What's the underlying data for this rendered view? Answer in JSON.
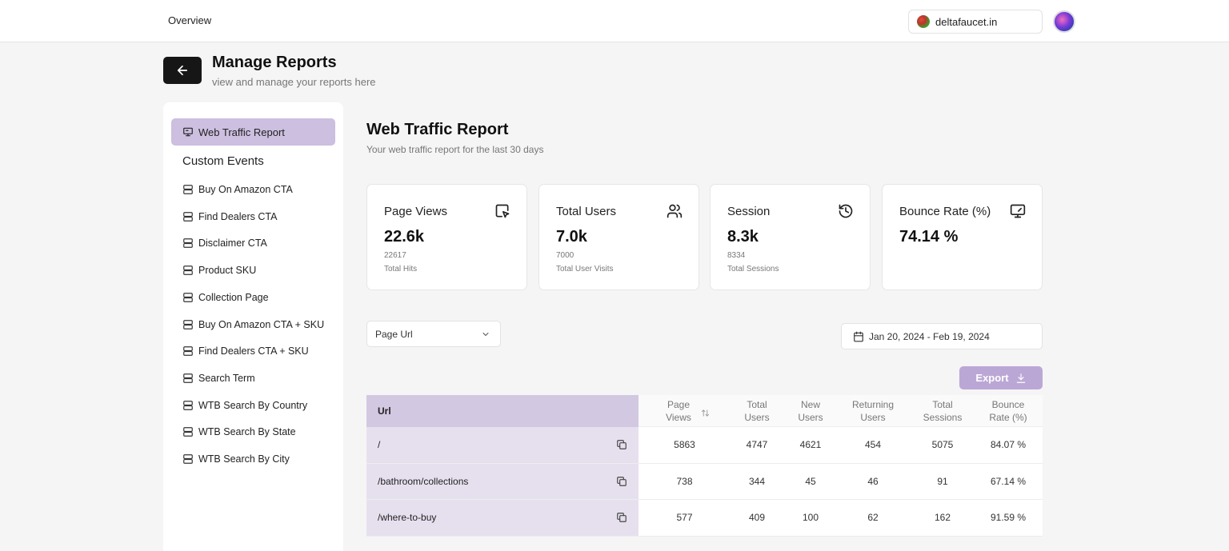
{
  "topbar": {
    "nav_overview": "Overview",
    "site": "deltafaucet.in"
  },
  "header": {
    "title": "Manage Reports",
    "subtitle": "view and manage your reports here"
  },
  "sidebar": {
    "active_item": "Web Traffic Report",
    "section_heading": "Custom Events",
    "items": [
      "Buy On Amazon CTA",
      "Find Dealers CTA",
      "Disclaimer CTA",
      "Product SKU",
      "Collection Page",
      "Buy On Amazon CTA + SKU",
      "Find Dealers CTA + SKU",
      "Search Term",
      "WTB Search By Country",
      "WTB Search By State",
      "WTB Search By City"
    ]
  },
  "report": {
    "title": "Web Traffic Report",
    "subtitle": "Your web traffic report for the last 30 days"
  },
  "cards": [
    {
      "title": "Page Views",
      "value": "22.6k",
      "raw": "22617",
      "caption": "Total Hits",
      "icon": "cursor-click-icon"
    },
    {
      "title": "Total Users",
      "value": "7.0k",
      "raw": "7000",
      "caption": "Total User Visits",
      "icon": "users-icon"
    },
    {
      "title": "Session",
      "value": "8.3k",
      "raw": "8334",
      "caption": "Total Sessions",
      "icon": "history-icon"
    },
    {
      "title": "Bounce Rate (%)",
      "value": "74.14 %",
      "raw": "",
      "caption": "",
      "icon": "monitor-icon"
    }
  ],
  "controls": {
    "dimension": "Page Url",
    "date_range": "Jan 20, 2024 - Feb 19, 2024",
    "export_label": "Export"
  },
  "table": {
    "headers": {
      "url": "Url",
      "page_views_1": "Page",
      "page_views_2": "Views",
      "total_users_1": "Total",
      "total_users_2": "Users",
      "new_users_1": "New",
      "new_users_2": "Users",
      "returning_users_1": "Returning",
      "returning_users_2": "Users",
      "total_sessions_1": "Total",
      "total_sessions_2": "Sessions",
      "bounce_rate_1": "Bounce",
      "bounce_rate_2": "Rate (%)"
    },
    "rows": [
      {
        "url": "/",
        "page_views": "5863",
        "total_users": "4747",
        "new_users": "4621",
        "returning_users": "454",
        "total_sessions": "5075",
        "bounce_rate": "84.07 %"
      },
      {
        "url": "/bathroom/collections",
        "page_views": "738",
        "total_users": "344",
        "new_users": "45",
        "returning_users": "46",
        "total_sessions": "91",
        "bounce_rate": "67.14 %"
      },
      {
        "url": "/where-to-buy",
        "page_views": "577",
        "total_users": "409",
        "new_users": "100",
        "returning_users": "62",
        "total_sessions": "162",
        "bounce_rate": "91.59 %"
      }
    ]
  }
}
